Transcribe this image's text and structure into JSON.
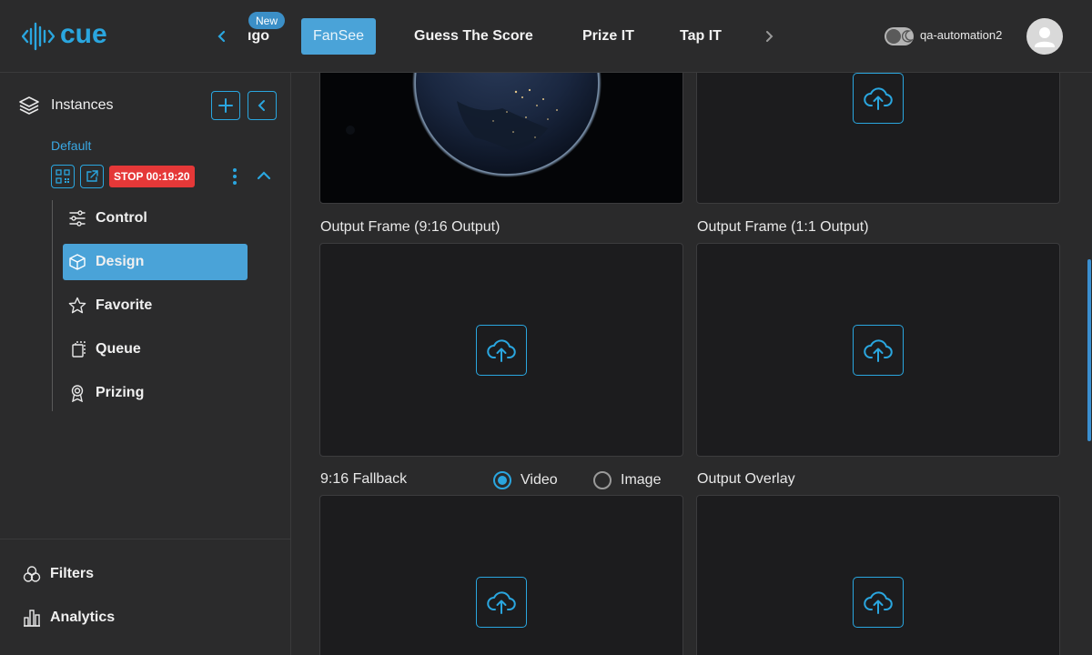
{
  "app": {
    "logo_text": "cue",
    "brand_color": "#2aa6df"
  },
  "header": {
    "tabs": [
      {
        "label": "ıgo",
        "badge": "New"
      },
      {
        "label": "FanSee",
        "active": true
      },
      {
        "label": "Guess The Score"
      },
      {
        "label": "Prize IT"
      },
      {
        "label": "Tap IT"
      }
    ],
    "username": "qa-automation2",
    "theme_toggle": "dark"
  },
  "sidebar": {
    "section_title": "Instances",
    "instance_name": "Default",
    "stop_label": "STOP 00:19:20",
    "menu": [
      {
        "label": "Control",
        "icon": "sliders-icon"
      },
      {
        "label": "Design",
        "icon": "cube-icon",
        "active": true
      },
      {
        "label": "Favorite",
        "icon": "star-icon"
      },
      {
        "label": "Queue",
        "icon": "queue-icon"
      },
      {
        "label": "Prizing",
        "icon": "award-icon"
      }
    ],
    "bottom": [
      {
        "label": "Filters",
        "icon": "filters-icon"
      },
      {
        "label": "Analytics",
        "icon": "analytics-icon"
      }
    ]
  },
  "main": {
    "output_frame_916_label": "Output Frame (9:16 Output)",
    "output_frame_11_label": "Output Frame (1:1 Output)",
    "fallback_label": "9:16 Fallback",
    "fallback_options": [
      {
        "label": "Video",
        "selected": true
      },
      {
        "label": "Image",
        "selected": false
      }
    ],
    "output_overlay_label": "Output Overlay"
  }
}
